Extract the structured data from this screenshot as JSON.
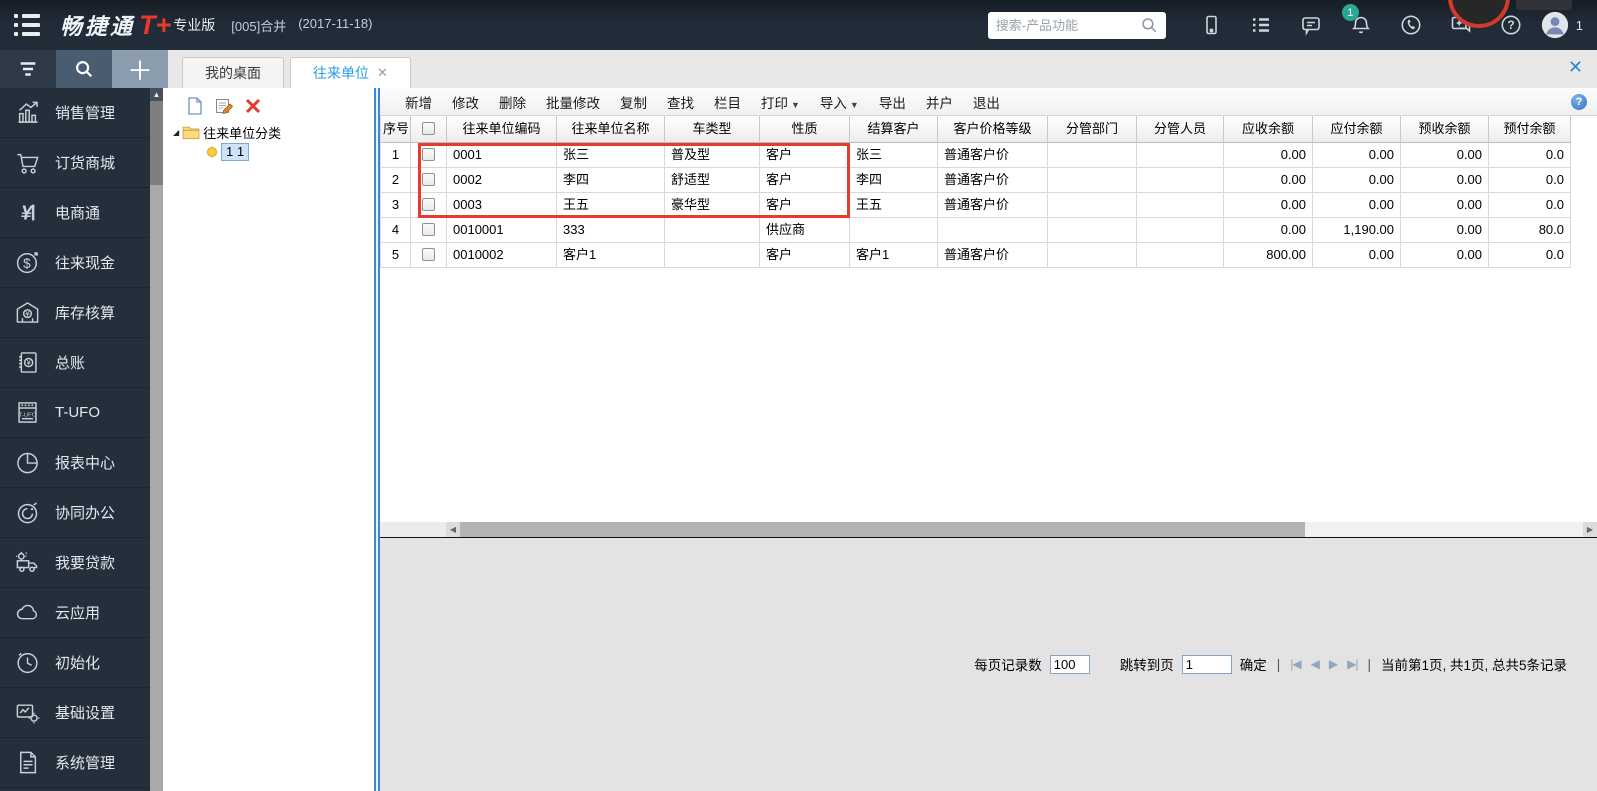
{
  "app": {
    "brand": "畅捷通",
    "brand_mark": "T+",
    "edition": "专业版",
    "account": "[005]合并",
    "date": "(2017-11-18)",
    "search_placeholder": "搜索-产品功能",
    "bell_badge": "1",
    "avatar_count": "1",
    "accent_color": "#e8392b",
    "topbar_color": "#222d3a"
  },
  "tabs": [
    {
      "label": "我的桌面",
      "active": false,
      "closable": false
    },
    {
      "label": "往来单位",
      "active": true,
      "closable": true
    }
  ],
  "close_all_label": "✕",
  "sidebar": {
    "items": [
      {
        "icon": "bar-chart-icon",
        "label": "销售管理"
      },
      {
        "icon": "cart-icon",
        "label": "订货商城"
      },
      {
        "icon": "ecommerce-icon",
        "label": "电商通"
      },
      {
        "icon": "dollar-circle-icon",
        "label": "往来现金"
      },
      {
        "icon": "warehouse-icon",
        "label": "库存核算"
      },
      {
        "icon": "ledger-icon",
        "label": "总账"
      },
      {
        "icon": "t-ufo-icon",
        "label": "T-UFO"
      },
      {
        "icon": "pie-chart-icon",
        "label": "报表中心"
      },
      {
        "icon": "collab-icon",
        "label": "协同办公"
      },
      {
        "icon": "loan-truck-icon",
        "label": "我要贷款"
      },
      {
        "icon": "cloud-icon",
        "label": "云应用"
      },
      {
        "icon": "clock-icon",
        "label": "初始化"
      },
      {
        "icon": "base-settings-icon",
        "label": "基础设置"
      },
      {
        "icon": "system-icon",
        "label": "系统管理"
      }
    ]
  },
  "tree": {
    "root_label": "往来单位分类",
    "child_label": "1 1"
  },
  "toolbar": {
    "buttons": [
      {
        "label": "新增"
      },
      {
        "label": "修改"
      },
      {
        "label": "删除"
      },
      {
        "label": "批量修改"
      },
      {
        "label": "复制"
      },
      {
        "label": "查找"
      },
      {
        "label": "栏目"
      },
      {
        "label": "打印",
        "dropdown": true
      },
      {
        "label": "导入",
        "dropdown": true
      },
      {
        "label": "导出"
      },
      {
        "label": "并户"
      },
      {
        "label": "退出"
      }
    ]
  },
  "table": {
    "columns": [
      "序号",
      "往来单位编码",
      "往来单位名称",
      "车类型",
      "性质",
      "结算客户",
      "客户价格等级",
      "分管部门",
      "分管人员",
      "应收余额",
      "应付余额",
      "预收余额",
      "预付余额"
    ],
    "rows": [
      {
        "seq": "1",
        "cells": [
          "0001",
          "张三",
          "普及型",
          "客户",
          "张三",
          "普通客户价",
          "",
          "",
          "0.00",
          "0.00",
          "0.00",
          "0.0"
        ]
      },
      {
        "seq": "2",
        "cells": [
          "0002",
          "李四",
          "舒适型",
          "客户",
          "李四",
          "普通客户价",
          "",
          "",
          "0.00",
          "0.00",
          "0.00",
          "0.0"
        ]
      },
      {
        "seq": "3",
        "cells": [
          "0003",
          "王五",
          "豪华型",
          "客户",
          "王五",
          "普通客户价",
          "",
          "",
          "0.00",
          "0.00",
          "0.00",
          "0.0"
        ]
      },
      {
        "seq": "4",
        "cells": [
          "0010001",
          "333",
          "",
          "供应商",
          "",
          "",
          "",
          "",
          "0.00",
          "1,190.00",
          "0.00",
          "80.0"
        ]
      },
      {
        "seq": "5",
        "cells": [
          "0010002",
          "客户1",
          "",
          "客户",
          "客户1",
          "普通客户价",
          "",
          "",
          "800.00",
          "0.00",
          "0.00",
          "0.0"
        ]
      }
    ],
    "highlight_color": "#e73b2c"
  },
  "pagination": {
    "per_page_label": "每页记录数",
    "per_page_value": "100",
    "goto_label": "跳转到页",
    "goto_value": "1",
    "confirm_label": "确定",
    "icons": {
      "first": "|◀",
      "prev": "◀",
      "next": "▶",
      "last": "▶|"
    },
    "status": "当前第1页, 共1页, 总共5条记录"
  }
}
